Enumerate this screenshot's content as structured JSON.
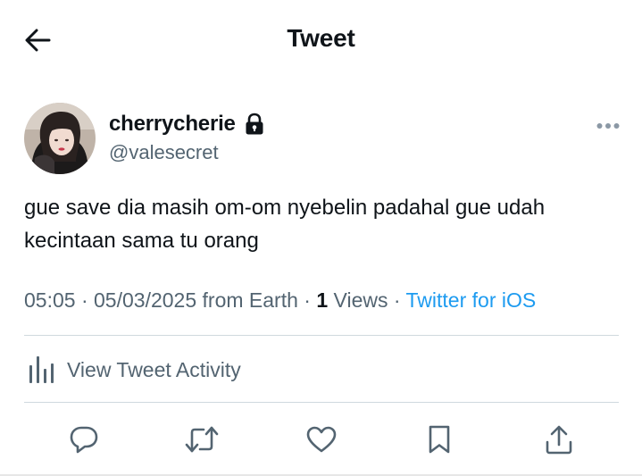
{
  "header": {
    "title": "Tweet",
    "back_icon": "arrow-left-icon"
  },
  "author": {
    "display_name": "cherrycherie",
    "handle": "@valesecret",
    "protected_icon": "lock-icon",
    "more_icon": "ellipsis-icon"
  },
  "tweet": {
    "text": "gue save dia masih om-om nyebelin padahal gue udah kecintaan sama tu orang"
  },
  "meta": {
    "time": "05:05",
    "sep1": " · ",
    "date": "05/03/2025",
    "location": " from Earth",
    "sep2": " · ",
    "views_count": "1",
    "views_label": " Views",
    "sep3": " · ",
    "source": "Twitter for iOS"
  },
  "activity": {
    "label": "View Tweet Activity",
    "icon": "bar-chart-icon"
  },
  "actions": [
    {
      "name": "reply",
      "icon": "reply-icon"
    },
    {
      "name": "retweet",
      "icon": "retweet-icon"
    },
    {
      "name": "like",
      "icon": "heart-icon"
    },
    {
      "name": "bookmark",
      "icon": "bookmark-icon"
    },
    {
      "name": "share",
      "icon": "share-icon"
    }
  ],
  "colors": {
    "text_primary": "#0f1419",
    "text_secondary": "#536471",
    "link": "#1d9bf0",
    "divider": "#cfd9de"
  }
}
